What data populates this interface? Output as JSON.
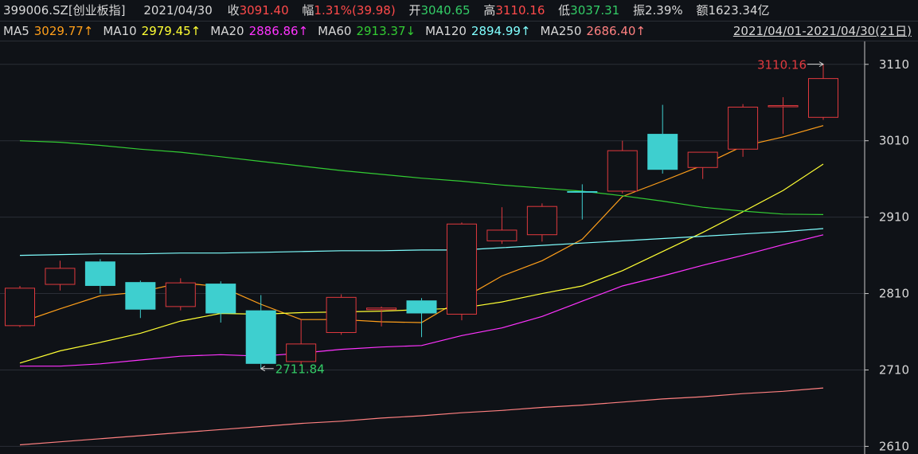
{
  "header": {
    "symbol": "399006.SZ[创业板指]",
    "date": "2021/04/30",
    "close_label": "收",
    "close_value": "3091.40",
    "change_label": "幅",
    "change_value": "1.31%(39.98)",
    "open_label": "开",
    "open_value": "3040.65",
    "high_label": "高",
    "high_value": "3110.16",
    "low_label": "低",
    "low_value": "3037.31",
    "amplitude_label": "振",
    "amplitude_value": "2.39%",
    "amount_label": "额",
    "amount_value": "1623.34亿"
  },
  "ma_bar": {
    "items": [
      {
        "label": "MA5",
        "value": "3029.77↑",
        "color": "#ff9f1a"
      },
      {
        "label": "MA10",
        "value": "2979.45↑",
        "color": "#ffff33"
      },
      {
        "label": "MA20",
        "value": "2886.86↑",
        "color": "#ff33ff"
      },
      {
        "label": "MA60",
        "value": "2913.37↓",
        "color": "#33cc33"
      },
      {
        "label": "MA120",
        "value": "2894.99↑",
        "color": "#80ffff"
      },
      {
        "label": "MA250",
        "value": "2686.40↑",
        "color": "#ff8080"
      }
    ],
    "range": "2021/04/01-2021/04/30(21日)"
  },
  "colors": {
    "up": "#e0393e",
    "down": "#3ecfcf",
    "grid": "#2a2e36",
    "axis_text": "#d8d8d8",
    "change_text": "#ff4a4a",
    "open_text": "#33cc66"
  },
  "chart_data": {
    "type": "candlestick",
    "ylim": [
      2600,
      3140
    ],
    "y_ticks": [
      2610,
      2710,
      2810,
      2910,
      3010,
      3110
    ],
    "candles": [
      {
        "open": 2768,
        "close": 2817,
        "high": 2820,
        "low": 2766
      },
      {
        "open": 2822,
        "close": 2843,
        "high": 2853,
        "low": 2814
      },
      {
        "open": 2852,
        "close": 2820,
        "high": 2855,
        "low": 2810
      },
      {
        "open": 2825,
        "close": 2789,
        "high": 2827,
        "low": 2778
      },
      {
        "open": 2793,
        "close": 2824,
        "high": 2830,
        "low": 2788
      },
      {
        "open": 2823,
        "close": 2784,
        "high": 2826,
        "low": 2772
      },
      {
        "open": 2788,
        "close": 2718,
        "high": 2808,
        "low": 2711.84
      },
      {
        "open": 2721,
        "close": 2744,
        "high": 2776,
        "low": 2716
      },
      {
        "open": 2759,
        "close": 2805,
        "high": 2809,
        "low": 2756
      },
      {
        "open": 2789,
        "close": 2791,
        "high": 2793,
        "low": 2767
      },
      {
        "open": 2801,
        "close": 2784,
        "high": 2804,
        "low": 2753
      },
      {
        "open": 2783,
        "close": 2901,
        "high": 2903,
        "low": 2775
      },
      {
        "open": 2879,
        "close": 2893,
        "high": 2923,
        "low": 2875
      },
      {
        "open": 2887,
        "close": 2924,
        "high": 2928,
        "low": 2878
      },
      {
        "open": 2944,
        "close": 2942,
        "high": 2953,
        "low": 2907
      },
      {
        "open": 2944,
        "close": 2997,
        "high": 3010,
        "low": 2941
      },
      {
        "open": 3019,
        "close": 2972,
        "high": 3057,
        "low": 2967
      },
      {
        "open": 2975,
        "close": 2995,
        "high": 2995,
        "low": 2960
      },
      {
        "open": 2999,
        "close": 3054,
        "high": 3058,
        "low": 2989
      },
      {
        "open": 3055,
        "close": 3056,
        "high": 3067,
        "low": 3019
      },
      {
        "open": 3040.65,
        "close": 3091.4,
        "high": 3110.16,
        "low": 3037.31
      }
    ],
    "series": [
      {
        "name": "MA5",
        "color": "#ff9f1a",
        "values": [
          2772,
          2790,
          2807,
          2812,
          2824,
          2819,
          2796,
          2776,
          2776,
          2773,
          2772,
          2803,
          2833,
          2853,
          2881,
          2937,
          2957,
          2978,
          3003,
          3015,
          3029.77
        ]
      },
      {
        "name": "MA10",
        "color": "#ffff33",
        "values": [
          2719,
          2735,
          2746,
          2758,
          2774,
          2784,
          2783,
          2785,
          2786,
          2787,
          2789,
          2791,
          2799,
          2810,
          2820,
          2840,
          2865,
          2890,
          2917,
          2945,
          2979.45
        ]
      },
      {
        "name": "MA20",
        "color": "#ff33ff",
        "values": [
          2715,
          2715,
          2718,
          2723,
          2728,
          2730,
          2728,
          2732,
          2737,
          2740,
          2742,
          2755,
          2765,
          2780,
          2800,
          2820,
          2833,
          2847,
          2860,
          2874,
          2886.86
        ]
      },
      {
        "name": "MA60",
        "color": "#33cc33",
        "values": [
          3010,
          3008,
          3004,
          2999,
          2995,
          2989,
          2983,
          2977,
          2971,
          2966,
          2961,
          2957,
          2952,
          2948,
          2944,
          2938,
          2931,
          2923,
          2918,
          2914,
          2913.37
        ]
      },
      {
        "name": "MA120",
        "color": "#80ffff",
        "values": [
          2860,
          2861,
          2862,
          2862,
          2863,
          2863,
          2864,
          2865,
          2866,
          2866,
          2867,
          2867,
          2870,
          2873,
          2876,
          2879,
          2882,
          2885,
          2888,
          2891,
          2894.99
        ]
      },
      {
        "name": "MA250",
        "color": "#ff8080",
        "values": [
          2612,
          2616,
          2620,
          2624,
          2628,
          2632,
          2636,
          2640,
          2643,
          2647,
          2650,
          2654,
          2657,
          2661,
          2664,
          2668,
          2672,
          2675,
          2679,
          2682,
          2686.4
        ]
      }
    ],
    "annotations": [
      {
        "text": "3110.16",
        "candle": 20,
        "kind": "high",
        "color": "#e0393e"
      },
      {
        "text": "2711.84",
        "candle": 6,
        "kind": "low",
        "color": "#33cc66"
      }
    ]
  }
}
